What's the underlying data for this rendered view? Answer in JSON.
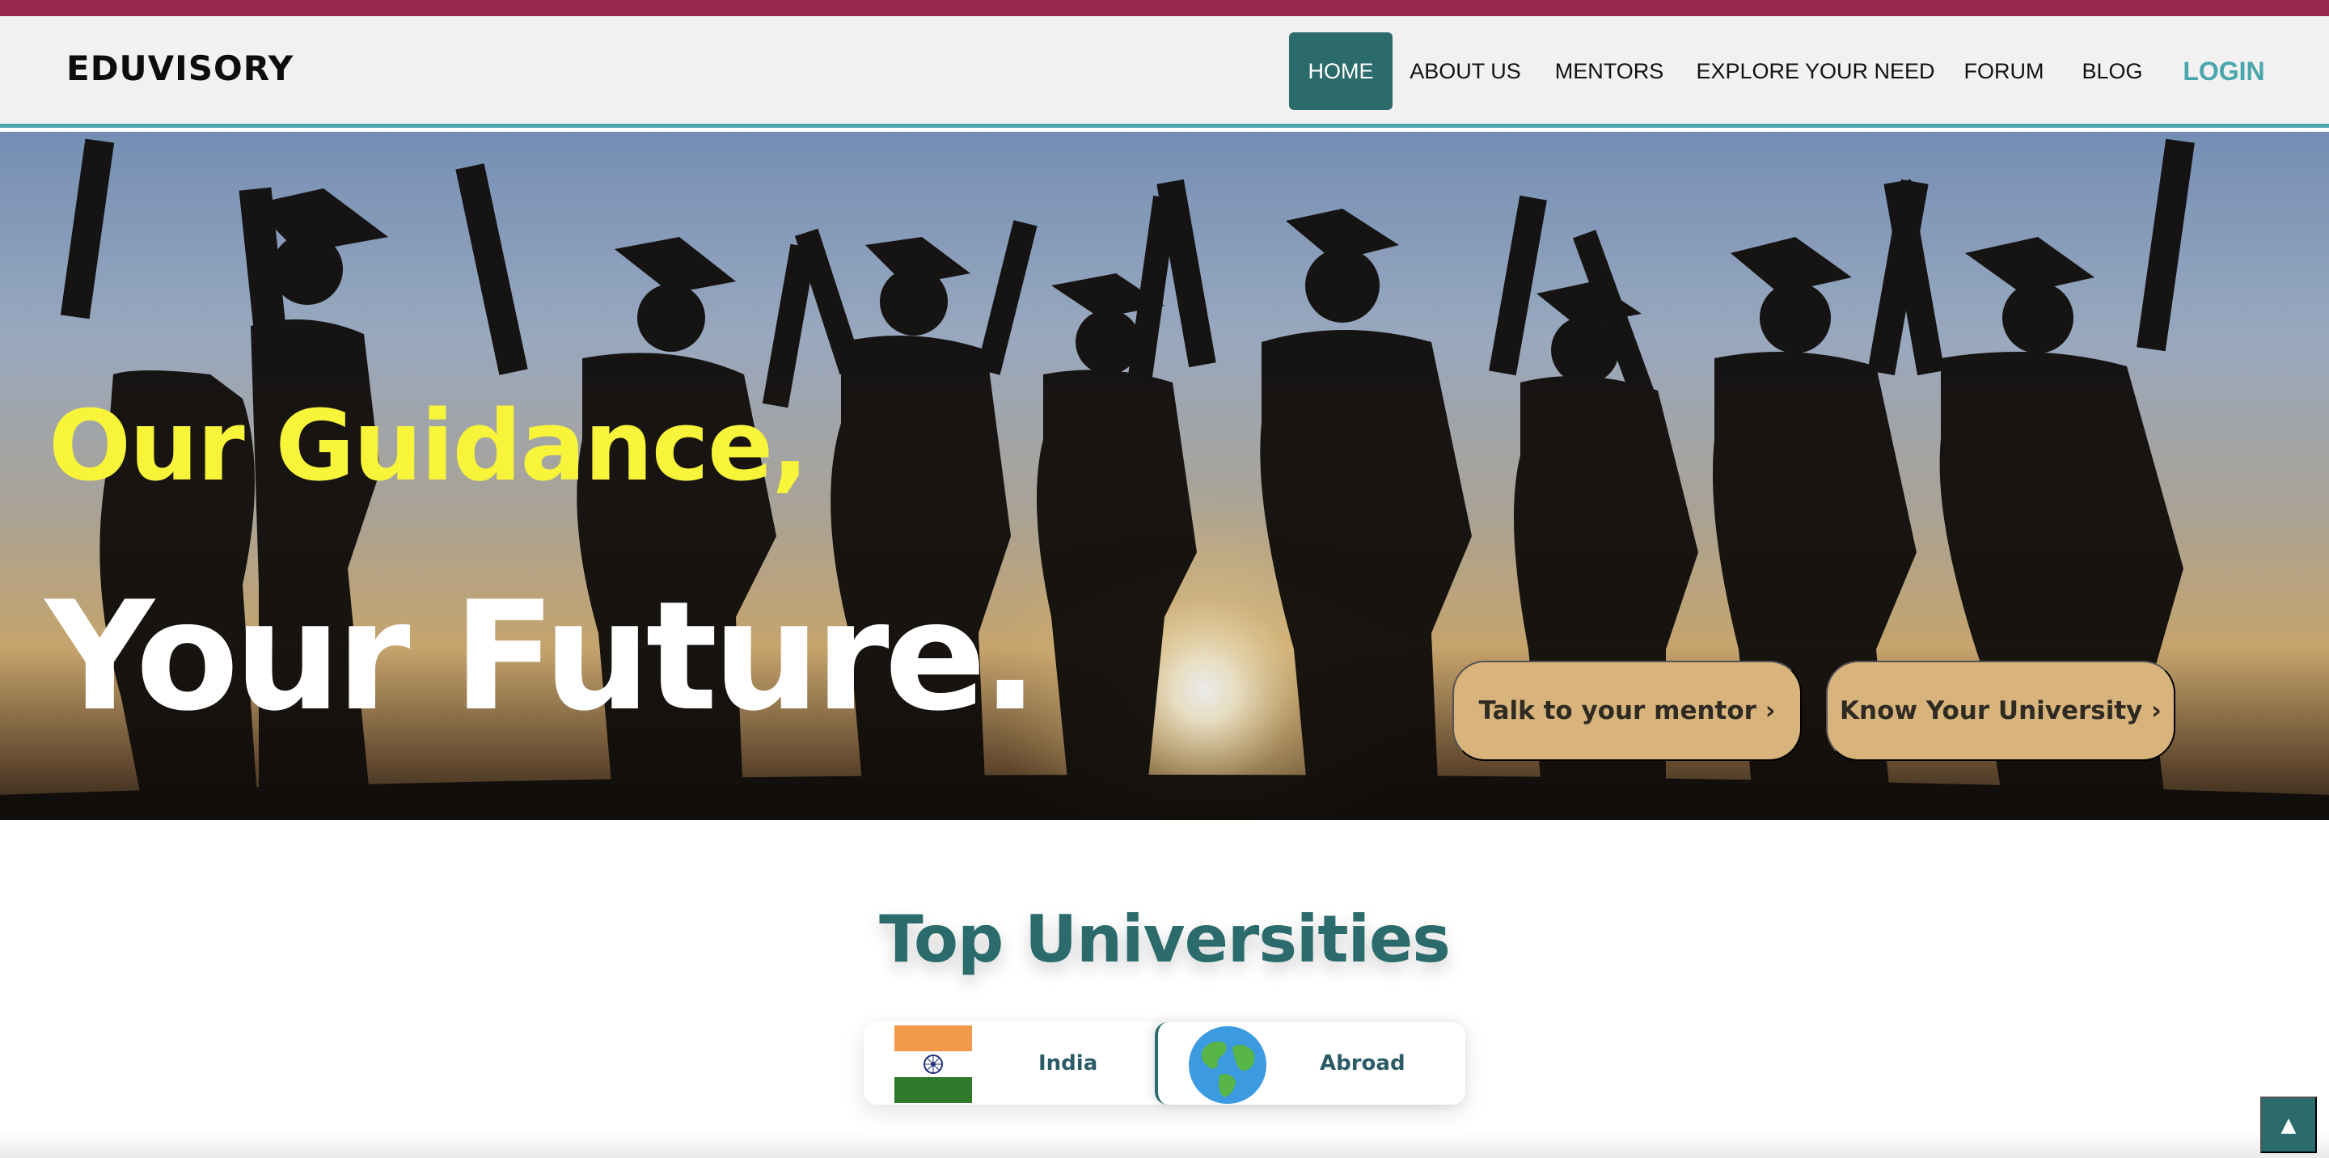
{
  "brand": {
    "name": "EDUVISORY"
  },
  "nav": {
    "items": [
      "HOME",
      "ABOUT US",
      "MENTORS",
      "EXPLORE YOUR NEED",
      "FORUM",
      "BLOG"
    ],
    "login": "LOGIN",
    "active": "HOME"
  },
  "hero": {
    "line1": "Our Guidance,",
    "line2": "Your Future.",
    "buttons": {
      "mentor": "Talk to your mentor ›",
      "university": "Know Your University ›"
    }
  },
  "universities": {
    "title": "Top Universities",
    "tabs": [
      {
        "label": "India",
        "icon": "india-flag-icon"
      },
      {
        "label": "Abroad",
        "icon": "globe-icon"
      }
    ]
  },
  "scroll_top": {
    "icon": "▲"
  },
  "colors": {
    "topbar": "#98284f",
    "accent": "#2b6b6b",
    "login": "#4aa6ad",
    "headline_yellow": "#f7f43a",
    "cta": "#d8b47c"
  }
}
